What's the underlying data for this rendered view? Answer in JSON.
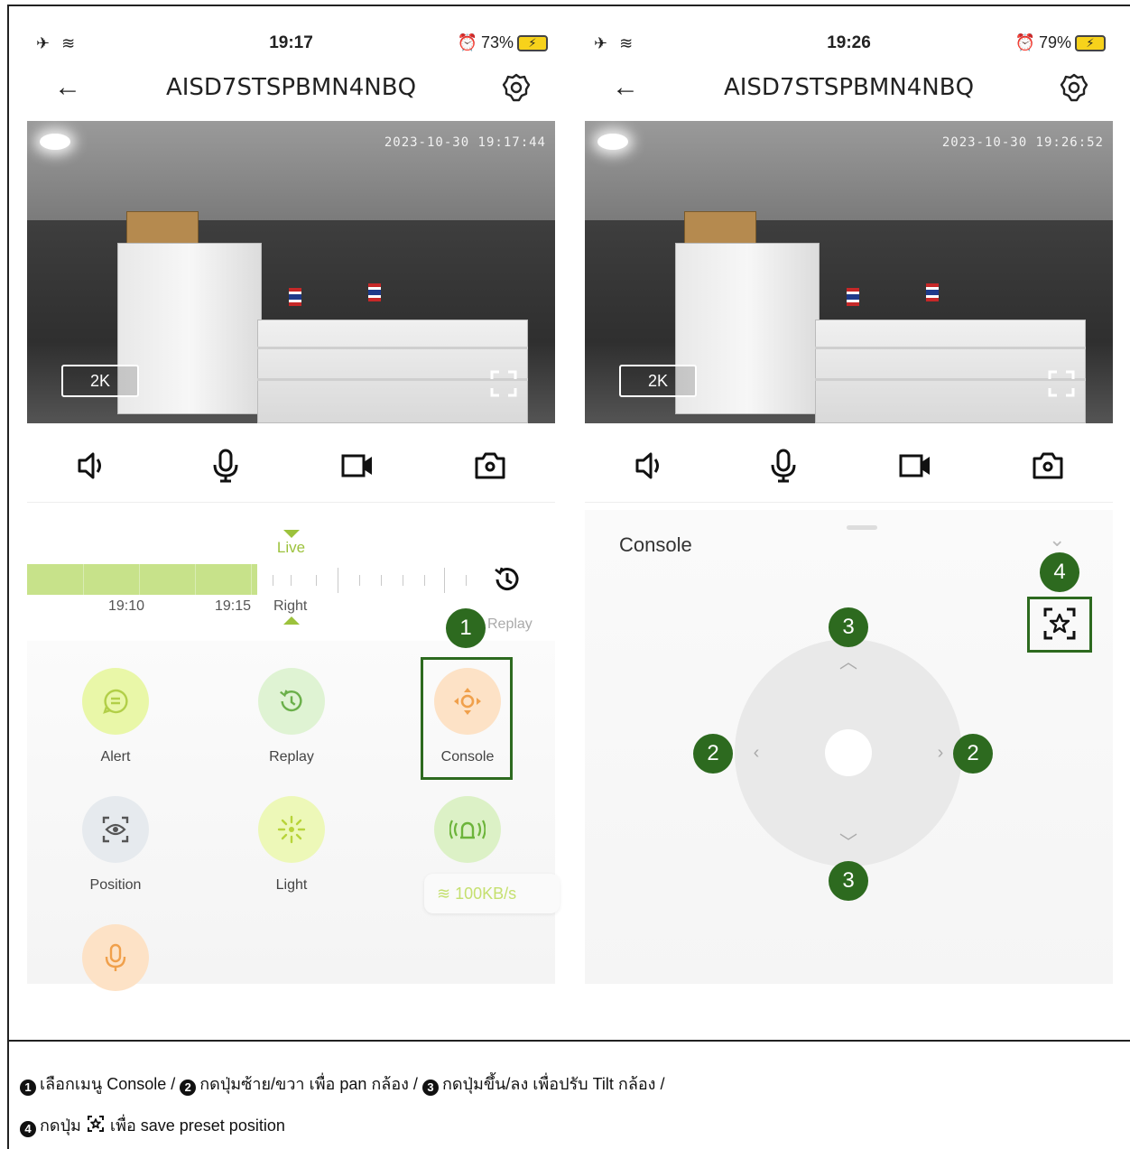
{
  "left_phone": {
    "status": {
      "time": "19:17",
      "battery": "73%"
    },
    "title": "AISD7STSPBMN4NBQ",
    "video": {
      "timestamp": "2023-10-30 19:17:44",
      "quality": "2K"
    },
    "timeline": {
      "live_label": "Live",
      "right_label": "Right",
      "replay_label": "Replay",
      "time_labels": [
        "19:10",
        "19:15"
      ]
    },
    "menu": {
      "items": [
        {
          "label": "Alert",
          "icon": "message-icon",
          "color": "#e9f7a8"
        },
        {
          "label": "Replay",
          "icon": "history-icon",
          "color": "#dff3d3"
        },
        {
          "label": "Console",
          "icon": "ptz-icon",
          "color": "#fde2c6"
        },
        {
          "label": "Position",
          "icon": "eye-scan-icon",
          "color": "#e6eaee"
        },
        {
          "label": "Light",
          "icon": "light-icon",
          "color": "#edf8b8"
        },
        {
          "label": "",
          "icon": "alarm-icon",
          "color": "#dcf1c6"
        },
        {
          "label": "",
          "icon": "microphone-icon",
          "color": "#fde2c6"
        }
      ],
      "speed": "100KB/s"
    },
    "badge": "1"
  },
  "right_phone": {
    "status": {
      "time": "19:26",
      "battery": "79%"
    },
    "title": "AISD7STSPBMN4NBQ",
    "video": {
      "timestamp": "2023-10-30 19:26:52",
      "quality": "2K"
    },
    "console": {
      "title": "Console"
    },
    "badges": {
      "left": "2",
      "right": "2",
      "up": "3",
      "down": "3",
      "preset": "4"
    }
  },
  "caption": {
    "line1": [
      {
        "num": "1",
        "text": "เลือกเมนู Console / "
      },
      {
        "num": "2",
        "text": "กดปุ่มซ้าย/ขวา เพื่อ pan กล้อง / "
      },
      {
        "num": "3",
        "text": "กดปุ่มขึ้น/ลง เพื่อปรับ Tilt กล้อง /"
      }
    ],
    "line2_num": "4",
    "line2_before": "กดปุ่ม",
    "line2_after": "เพื่อ save preset position"
  },
  "colors": {
    "accent_green": "#9cc23c",
    "badge_green": "#2d6a1f",
    "timeline_fill": "#c7e28a"
  }
}
